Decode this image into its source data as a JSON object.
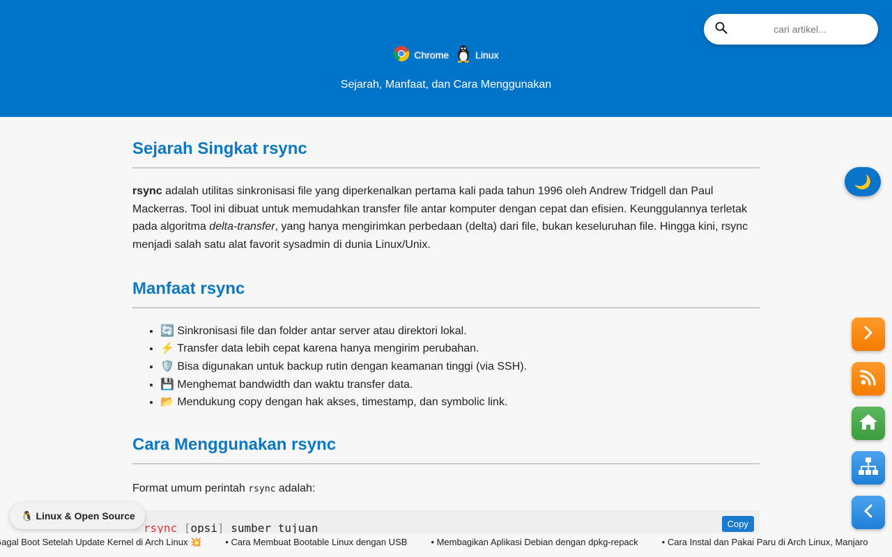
{
  "header": {
    "brand_links": [
      {
        "label": "Chrome",
        "icon": "chrome-icon"
      },
      {
        "label": "Linux",
        "icon": "tux-icon"
      }
    ],
    "subtitle": "Sejarah, Manfaat, dan Cara Menggunakan",
    "background_color": "#0074c8"
  },
  "search": {
    "placeholder": "cari artikel...",
    "value": "",
    "icon": "search-icon"
  },
  "article": {
    "section1": {
      "heading": "Sejarah Singkat rsync",
      "bold_term": "rsync",
      "text_a": " adalah utilitas sinkronisasi file yang diperkenalkan pertama kali pada tahun 1996 oleh Andrew Tridgell dan Paul Mackerras. Tool ini dibuat untuk memudahkan transfer file antar komputer dengan cepat dan efisien. Keunggulannya terletak pada algoritma ",
      "italic_term": "delta-transfer",
      "text_b": ", yang hanya mengirimkan perbedaan (delta) dari file, bukan keseluruhan file. Hingga kini, rsync menjadi salah satu alat favorit sysadmin di dunia Linux/Unix."
    },
    "section2": {
      "heading": "Manfaat rsync",
      "items": [
        "🔄 Sinkronisasi file dan folder antar server atau direktori lokal.",
        "⚡ Transfer data lebih cepat karena hanya mengirim perubahan.",
        "🛡️ Bisa digunakan untuk backup rutin dengan keamanan tinggi (via SSH).",
        "💾 Menghemat bandwidth dan waktu transfer data.",
        "📂 Mendukung copy dengan hak akses, timestamp, dan symbolic link."
      ]
    },
    "section3": {
      "heading": "Cara Menggunakan rsync",
      "format_intro": "Format umum perintah ",
      "format_code": "rsync",
      "format_end": " adalah:",
      "code": {
        "cmd": "rsync",
        "bracket_open": "[",
        "opt": "opsi",
        "bracket_close": "]",
        "args": " sumber tujuan"
      },
      "copy_label": "Copy"
    }
  },
  "theme_toggle": {
    "icon": "moon-icon",
    "glyph": "🌙"
  },
  "side_buttons": [
    {
      "name": "next-article-button",
      "icon": "chevron-right-icon"
    },
    {
      "name": "rss-button",
      "icon": "rss-icon"
    },
    {
      "name": "home-button",
      "icon": "home-icon"
    },
    {
      "name": "sitemap-button",
      "icon": "sitemap-icon"
    },
    {
      "name": "prev-article-button",
      "icon": "chevron-left-icon"
    }
  ],
  "category_badge": {
    "glyph": "🐧",
    "label": "Linux & Open Source"
  },
  "ticker": {
    "items": [
      "Gagal Boot Setelah Update Kernel di Arch Linux 💥",
      "• Cara Membuat Bootable Linux dengan USB",
      "• Membagikan Aplikasi Debian dengan dpkg-repack",
      "• Cara Instal dan Pakai Paru di Arch Linux, Manjaro"
    ]
  }
}
